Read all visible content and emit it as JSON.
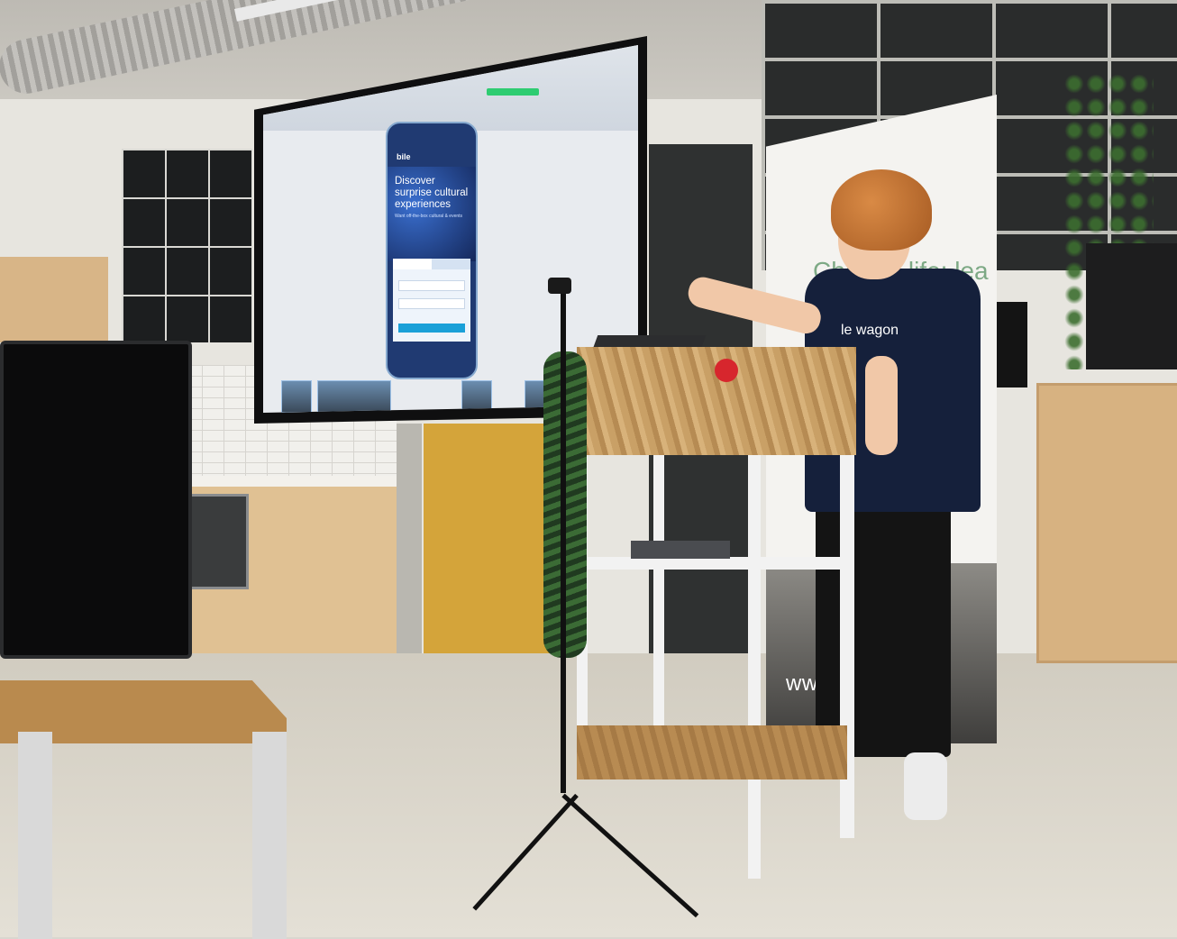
{
  "scene": {
    "description_kind": "photo"
  },
  "projected_slide": {
    "brand": "bile",
    "headline": "Discover surprise cultural experiences",
    "subtext": "Want off-the-box  cultural & events",
    "form_tab_1": "",
    "form_tab_2": "",
    "field_1_placeholder": "",
    "field_2_placeholder": ""
  },
  "banner": {
    "headline": "Change life: lea",
    "url": "www.l     on.c"
  },
  "tshirt": {
    "logo_text": "le wagon"
  },
  "lectern": {
    "logo_text": ""
  },
  "colors": {
    "slide_blue": "#203a72",
    "banner_green": "#7da985",
    "shirt_navy": "#15203b",
    "lectern_wood": "#c9a066",
    "logo_red": "#d7262d"
  }
}
